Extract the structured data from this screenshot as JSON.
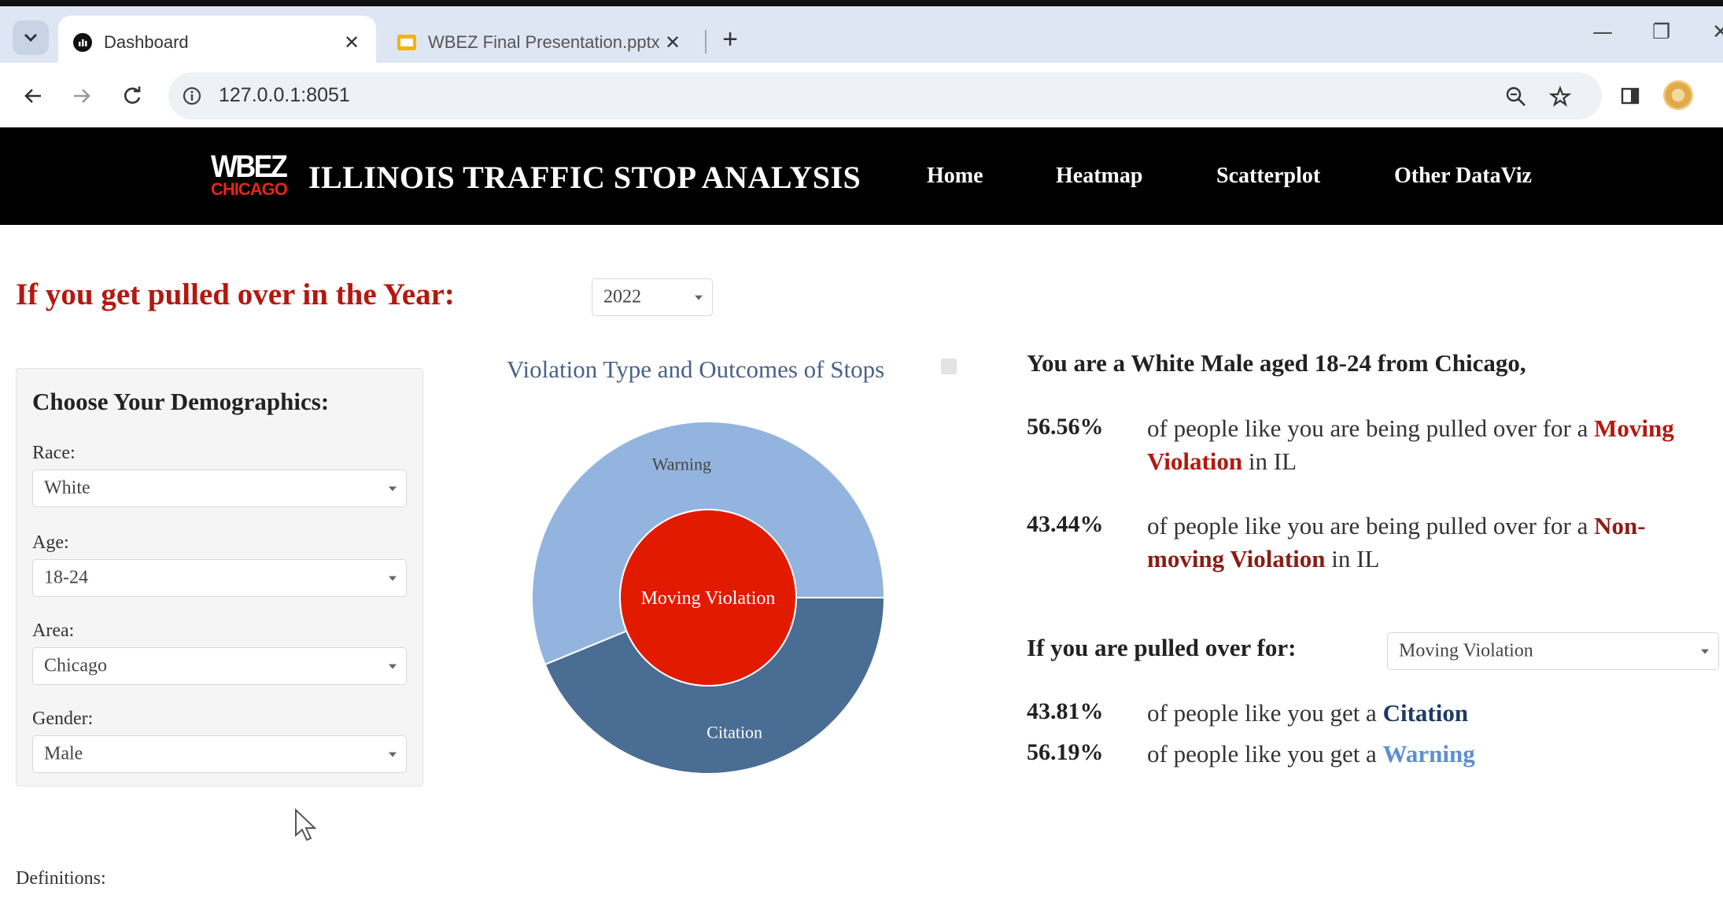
{
  "browser": {
    "tabs": [
      {
        "title": "Dashboard",
        "active": true
      },
      {
        "title": "WBEZ Final Presentation.pptx",
        "active": false
      }
    ],
    "url": "127.0.0.1:8051",
    "icons": [
      "tab-search-icon",
      "close-icon",
      "new-tab-icon",
      "minimize-icon",
      "restore-icon",
      "back-icon",
      "forward-icon",
      "reload-icon",
      "site-info-icon",
      "zoom-icon",
      "bookmark-star-icon",
      "side-panel-icon",
      "profile-avatar"
    ]
  },
  "header": {
    "logo_top": "WBEZ",
    "logo_bottom": "CHICAGO",
    "title": "ILLINOIS TRAFFIC STOP ANALYSIS",
    "nav": [
      "Home",
      "Heatmap",
      "Scatterplot",
      "Other DataViz"
    ]
  },
  "year": {
    "label": "If you get pulled over in the Year:",
    "value": "2022"
  },
  "demographics": {
    "title": "Choose Your Demographics:",
    "fields": [
      {
        "label": "Race:",
        "value": "White"
      },
      {
        "label": "Age:",
        "value": "18-24"
      },
      {
        "label": "Area:",
        "value": "Chicago"
      },
      {
        "label": "Gender:",
        "value": "Male"
      }
    ]
  },
  "definitions_label": "Definitions:",
  "chart_data": {
    "type": "pie",
    "title": "Violation Type and Outcomes of Stops",
    "inner": [
      {
        "label": "Moving Violation",
        "value": 100,
        "color": "#e21a00"
      }
    ],
    "outer": [
      {
        "label": "Warning",
        "value": 56.19,
        "color": "#93b4de"
      },
      {
        "label": "Citation",
        "value": 43.81,
        "color": "#4a6d94"
      }
    ]
  },
  "summary": {
    "headline": "You are a White Male aged 18-24 from Chicago,",
    "stats": [
      {
        "pct": "56.56%",
        "pre": "of people like you are being pulled over for a ",
        "em": "Moving Violation",
        "post": " in IL"
      },
      {
        "pct": "43.44%",
        "pre": "of people like you are being pulled over for a ",
        "em": "Non-moving Violation",
        "post": " in IL"
      }
    ],
    "pulled_label": "If you are pulled over for:",
    "pulled_value": "Moving Violation",
    "outcomes": [
      {
        "pct": "43.81%",
        "pre": "of people like you get a ",
        "em": "Citation"
      },
      {
        "pct": "56.19%",
        "pre": "of people like you get a ",
        "em": "Warning"
      }
    ]
  },
  "colors": {
    "accent_red": "#b5170f",
    "header_bg": "#000000",
    "citation": "#1e3a66",
    "warning": "#5c8fd0"
  }
}
